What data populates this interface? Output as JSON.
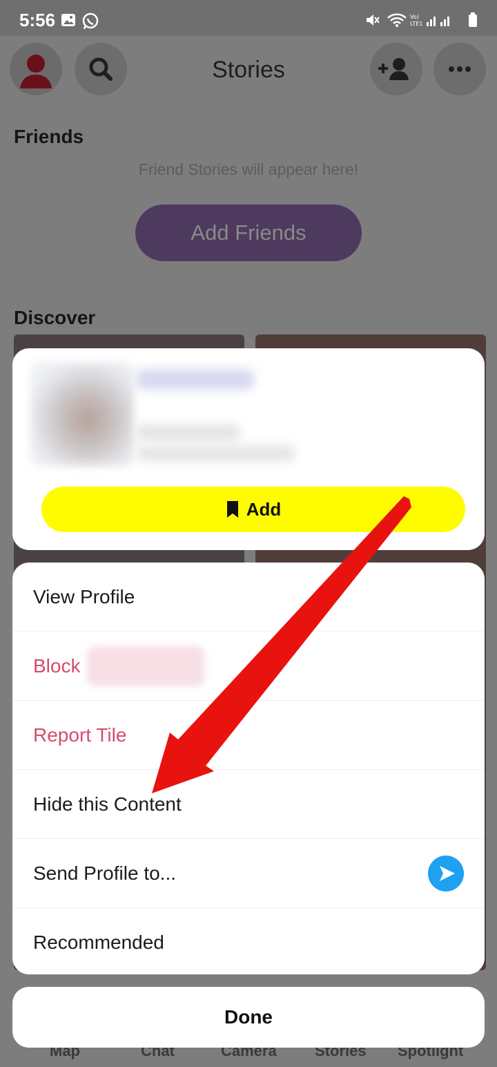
{
  "status_bar": {
    "time": "5:56"
  },
  "header": {
    "title": "Stories"
  },
  "friends": {
    "heading": "Friends",
    "empty_hint": "Friend Stories will appear here!",
    "add_friends_label": "Add Friends"
  },
  "discover": {
    "heading": "Discover"
  },
  "bottom_nav": {
    "items": [
      "Map",
      "Chat",
      "Camera",
      "Stories",
      "Spotlight"
    ]
  },
  "profile_card": {
    "add_label": "Add"
  },
  "sheet": {
    "items": [
      {
        "label": "View Profile"
      },
      {
        "label": "Block"
      },
      {
        "label": "Report Tile"
      },
      {
        "label": "Hide this Content"
      },
      {
        "label": "Send Profile to..."
      },
      {
        "label": "Recommended"
      }
    ]
  },
  "done_label": "Done",
  "colors": {
    "accent_yellow": "#fffc00",
    "danger_pink": "#d44d6d",
    "send_blue": "#1ea1f1",
    "arrow_red": "#e8130f",
    "add_friends_purple": "#4e3a5e"
  },
  "icons": [
    "image-icon",
    "whatsapp-icon",
    "mute-icon",
    "wifi-icon",
    "signal-icon",
    "battery-icon",
    "avatar-icon",
    "search-icon",
    "add-friend-icon",
    "more-icon",
    "bookmark-icon",
    "send-icon"
  ]
}
